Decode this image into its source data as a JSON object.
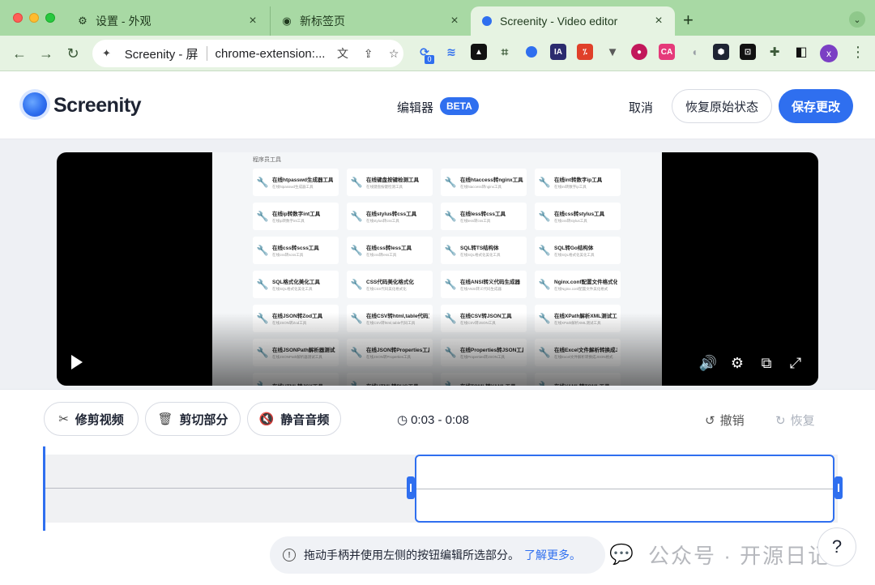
{
  "tabs": [
    {
      "title": "设置 - 外观",
      "icon": "gear-icon"
    },
    {
      "title": "新标签页",
      "icon": "chrome-icon"
    },
    {
      "title": "Screenity - Video editor",
      "icon": "screenity-icon",
      "active": true
    }
  ],
  "omnibox": {
    "page_title": "Screenity - 屏",
    "url": "chrome-extension:..."
  },
  "extensions": [
    {
      "name": "extension-badge-icon",
      "color": "#2f6fef",
      "badge": "0"
    },
    {
      "name": "extension-layers-icon",
      "color": "#2f6fef"
    },
    {
      "name": "extension-a-icon",
      "color": "#111111"
    },
    {
      "name": "extension-crop-icon",
      "color": "#3c5a39"
    },
    {
      "name": "extension-screenity-icon",
      "color": "#2f6fef"
    },
    {
      "name": "extension-ia-icon",
      "color": "#2b2b6e",
      "label": "IA"
    },
    {
      "name": "extension-translate-icon",
      "color": "#e0402a"
    },
    {
      "name": "extension-vue-icon",
      "color": "#5a5a5a"
    },
    {
      "name": "extension-color-icon",
      "color": "#c2185b"
    },
    {
      "name": "extension-ca-icon",
      "color": "#e53a7a",
      "label": "CA"
    },
    {
      "name": "extension-mouse-icon",
      "color": "#9aa0a6"
    },
    {
      "name": "extension-hex-icon",
      "color": "#1e2433"
    },
    {
      "name": "extension-square-icon",
      "color": "#111111"
    },
    {
      "name": "extension-puzzle-icon",
      "color": "#3c5a39"
    },
    {
      "name": "extension-sidebar-icon",
      "color": "#111111"
    }
  ],
  "profile": {
    "initial": "x"
  },
  "app": {
    "brand": "Screenity",
    "editor_label": "编辑器",
    "beta": "BETA",
    "cancel": "取消",
    "restore": "恢复原始状态",
    "save": "保存更改"
  },
  "video_screen": {
    "heading": "程序员工具",
    "cards": [
      {
        "title": "在线htpasswd生成器工具",
        "sub": "在线htpasswd生成器工具"
      },
      {
        "title": "在线键盘按键检测工具",
        "sub": "在线键盘按键检测工具"
      },
      {
        "title": "在线htaccess转nginx工具",
        "sub": "在线htaccess转nginx工具"
      },
      {
        "title": "在线int转数字ip工具",
        "sub": "在线int转数字ip工具"
      },
      {
        "title": "在线ip转数字int工具",
        "sub": "在线ip转数字int工具"
      },
      {
        "title": "在线stylus转css工具",
        "sub": "在线stylus转css工具"
      },
      {
        "title": "在线less转css工具",
        "sub": "在线less转css工具"
      },
      {
        "title": "在线css转stylus工具",
        "sub": "在线css转stylus工具"
      },
      {
        "title": "在线css转scss工具",
        "sub": "在线css转scss工具"
      },
      {
        "title": "在线css转less工具",
        "sub": "在线css转less工具"
      },
      {
        "title": "SQL转TS结构体",
        "sub": "在线SQL格式化美化工具"
      },
      {
        "title": "SQL转Go结构体",
        "sub": "在线SQL格式化美化工具"
      },
      {
        "title": "SQL格式化美化工具",
        "sub": "在线SQL格式化美化工具"
      },
      {
        "title": "CSS代码美化格式化",
        "sub": "在线CSS代码美化格式化"
      },
      {
        "title": "在线ANSI转义代码生成器",
        "sub": "在线ANSI转义代码生成器"
      },
      {
        "title": "Nginx.conf配置文件格式化",
        "sub": "在线Nginx.conf配置文件美化格式"
      },
      {
        "title": "在线JSON转Zod工具",
        "sub": "在线JSON转Zod工具"
      },
      {
        "title": "在线CSV转html,table代码工",
        "sub": "在线CSV转html,table代码工具"
      },
      {
        "title": "在线CSV转JSON工具",
        "sub": "在线CSV转JSON工具"
      },
      {
        "title": "在线XPath解析XML测试工",
        "sub": "在线XPath解析XML测试工具"
      },
      {
        "title": "在线JSONPath解析器测试工",
        "sub": "在线JSONPath解析器测试工具"
      },
      {
        "title": "在线JSON转Properties工具",
        "sub": "在线JSON转Properties工具"
      },
      {
        "title": "在线Properties转JSON工具",
        "sub": "在线Properties转JSON工具"
      },
      {
        "title": "在线Excel文件解析转换成JS",
        "sub": "在线Excel文件解析转换成JSON格式"
      },
      {
        "title": "在线HTML转JSX工具",
        "sub": ""
      },
      {
        "title": "在线HTML转PUG工具",
        "sub": ""
      },
      {
        "title": "在线TOML转YAML工具",
        "sub": ""
      },
      {
        "title": "在线YAML转TOML工具",
        "sub": ""
      }
    ]
  },
  "editor": {
    "trim": "修剪视频",
    "cut": "剪切部分",
    "mute": "静音音频",
    "time_range": "0:03 - 0:08",
    "undo": "撤销",
    "redo": "恢复"
  },
  "hint": {
    "text": "拖动手柄并使用左侧的按钮编辑所选部分。",
    "link": "了解更多。"
  },
  "watermark": "公众号 · 开源日记",
  "help": "?"
}
